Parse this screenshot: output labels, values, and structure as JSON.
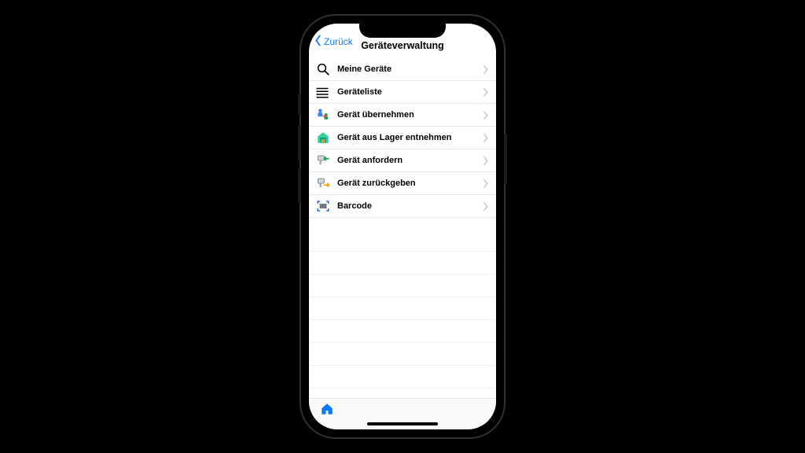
{
  "nav": {
    "back_label": "Zurück",
    "title": "Geräteverwaltung"
  },
  "menu": {
    "items": [
      {
        "icon": "search-icon",
        "label": "Meine Geräte"
      },
      {
        "icon": "list-icon",
        "label": "Geräteliste"
      },
      {
        "icon": "transfer-icon",
        "label": "Gerät übernehmen"
      },
      {
        "icon": "warehouse-icon",
        "label": "Gerät aus Lager entnehmen"
      },
      {
        "icon": "request-icon",
        "label": "Gerät anfordern"
      },
      {
        "icon": "return-icon",
        "label": "Gerät zurückgeben"
      },
      {
        "icon": "barcode-icon",
        "label": "Barcode"
      }
    ]
  },
  "tabbar": {
    "home_icon": "home-icon"
  },
  "colors": {
    "accent": "#0a7aff",
    "separator": "#e6e6e8",
    "chevron": "#c7c7cc"
  }
}
